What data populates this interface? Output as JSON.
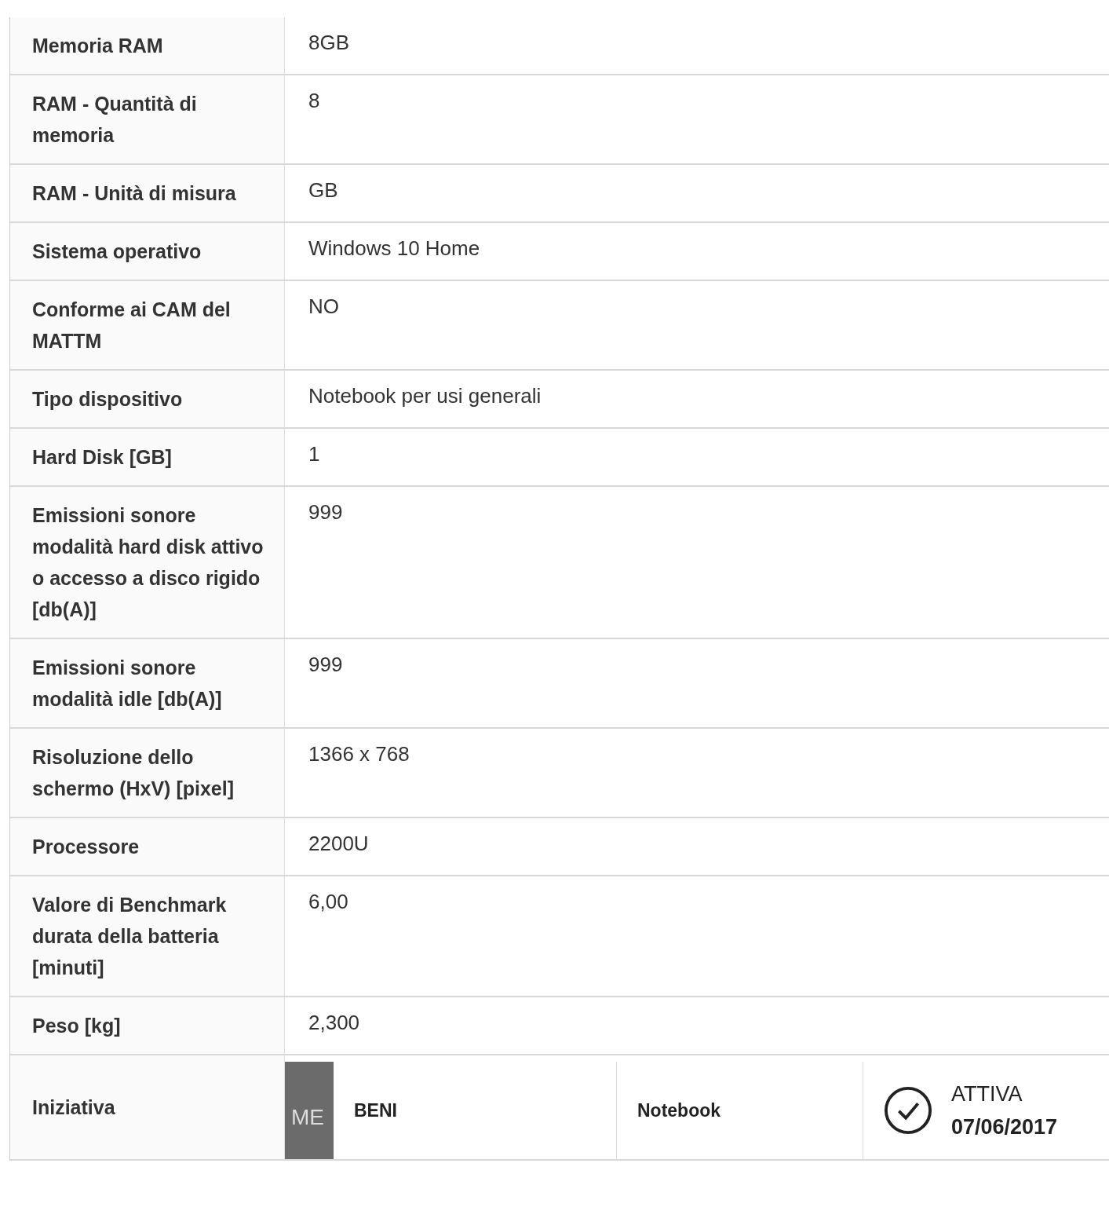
{
  "rows": [
    {
      "label": "Memoria RAM",
      "value": "8GB"
    },
    {
      "label": "RAM - Quantità di memoria",
      "value": "8"
    },
    {
      "label": "RAM - Unità di misura",
      "value": "GB"
    },
    {
      "label": "Sistema operativo",
      "value": "Windows 10 Home"
    },
    {
      "label": "Conforme ai CAM del MATTM",
      "value": "NO"
    },
    {
      "label": "Tipo dispositivo",
      "value": "Notebook per usi generali"
    },
    {
      "label": "Hard Disk [GB]",
      "value": "1"
    },
    {
      "label": "Emissioni sonore modalità hard disk attivo o accesso a disco rigido [db(A)]",
      "value": "999"
    },
    {
      "label": "Emissioni sonore modalità idle [db(A)]",
      "value": "999"
    },
    {
      "label": "Risoluzione dello schermo (HxV) [pixel]",
      "value": "1366 x 768"
    },
    {
      "label": "Processore",
      "value": "2200U"
    },
    {
      "label": "Valore di Benchmark durata della batteria [minuti]",
      "value": "6,00"
    },
    {
      "label": "Peso [kg]",
      "value": "2,300"
    }
  ],
  "initiative": {
    "label": "Iniziativa",
    "badge": "ME",
    "category": "BENI",
    "name": "Notebook",
    "status": "ATTIVA",
    "date": "07/06/2017",
    "active": true
  }
}
